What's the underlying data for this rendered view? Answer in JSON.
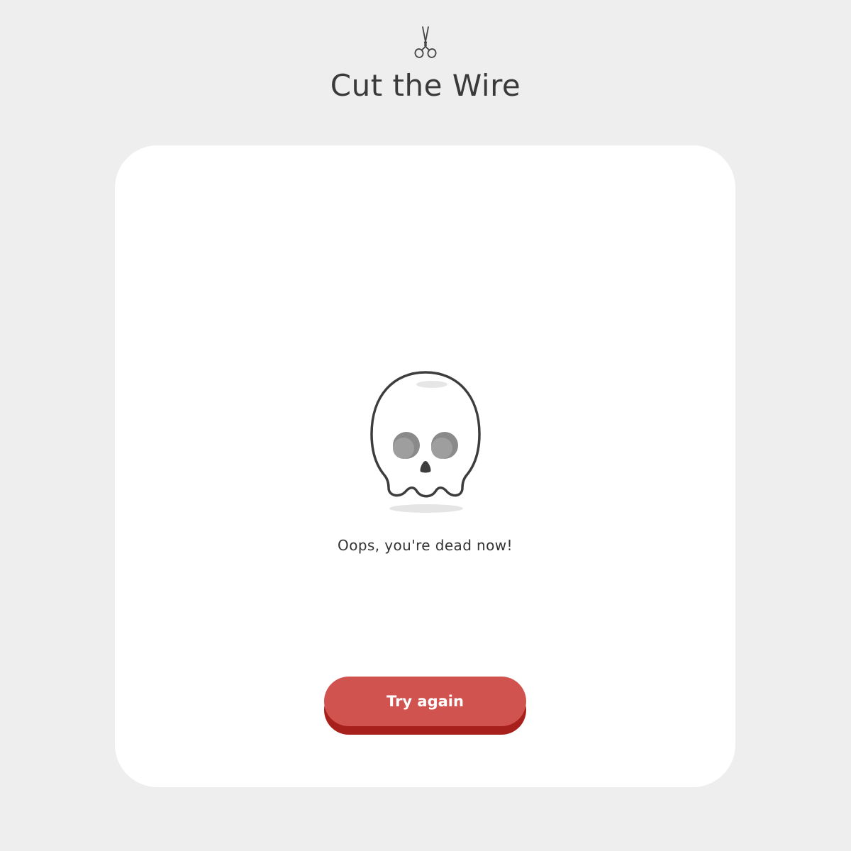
{
  "header": {
    "icon": "scissors-icon",
    "title": "Cut the Wire"
  },
  "result": {
    "icon": "skull-icon",
    "message": "Oops, you're dead now!"
  },
  "actions": {
    "retry_label": "Try again"
  },
  "colors": {
    "background": "#eeeeee",
    "card": "#ffffff",
    "button": "#d1534f",
    "button_shadow": "#a8201c",
    "text": "#333333"
  }
}
